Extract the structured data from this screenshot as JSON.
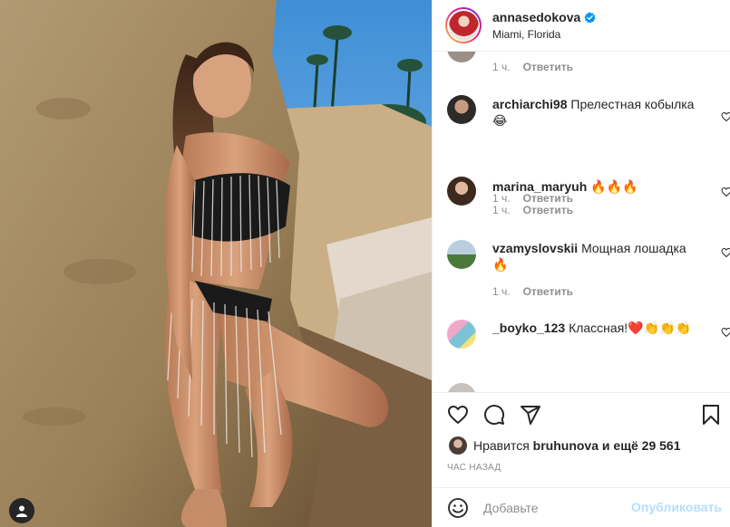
{
  "post": {
    "username": "annasedokova",
    "location": "Miami, Florida"
  },
  "comments": [
    {
      "username": "",
      "text": "",
      "time": "1 ч.",
      "reply": "Ответить"
    },
    {
      "username": "archiarchi98",
      "text": "Прелестная кобылка😂",
      "time": "1 ч.",
      "reply": "Ответить"
    },
    {
      "username": "marina_maryuh",
      "text": "🔥🔥🔥",
      "time": "1 ч.",
      "reply": "Ответить"
    },
    {
      "username": "vzamyslovskii",
      "text": "Мощная лошадка 🔥",
      "time": "1 ч.",
      "reply": "Ответить"
    },
    {
      "username": "_boyko_123",
      "text": "Классная!❤️👏👏👏",
      "time": "",
      "reply": ""
    }
  ],
  "likes": {
    "prefix": "Нравится",
    "user": "bruhunova",
    "suffix": "и ещё 29 561"
  },
  "time_ago": "ЧАС НАЗАД",
  "add_comment": {
    "placeholder": "Добавьте",
    "post_label": "Опубликовать"
  },
  "icons": {
    "like": "heart-icon",
    "comment": "comment-icon",
    "share": "share-icon",
    "save": "bookmark-icon",
    "emoji": "emoji-icon",
    "verified": "verified-badge-icon",
    "tag": "user-tag-icon"
  },
  "colors": {
    "verified": "#0095f6",
    "post_disabled": "#b2dffc",
    "muted": "#8e8e8e"
  }
}
